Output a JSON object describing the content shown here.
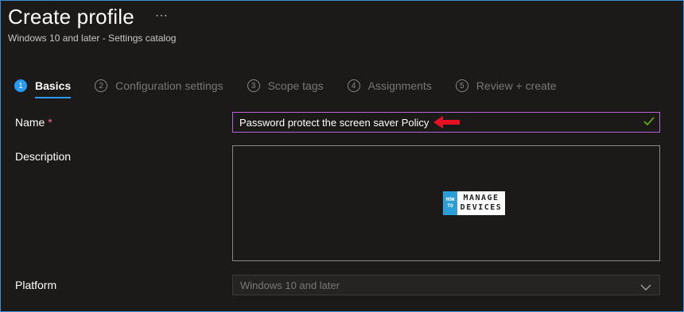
{
  "header": {
    "title": "Create profile",
    "more_label": "···",
    "subtitle": "Windows 10 and later - Settings catalog"
  },
  "tabs": [
    {
      "number": "1",
      "label": "Basics",
      "active": true
    },
    {
      "number": "2",
      "label": "Configuration settings",
      "active": false
    },
    {
      "number": "3",
      "label": "Scope tags",
      "active": false
    },
    {
      "number": "4",
      "label": "Assignments",
      "active": false
    },
    {
      "number": "5",
      "label": "Review + create",
      "active": false
    }
  ],
  "form": {
    "name": {
      "label": "Name",
      "required_marker": "*",
      "value": "Password protect the screen saver Policy"
    },
    "description": {
      "label": "Description",
      "value": ""
    },
    "platform": {
      "label": "Platform",
      "value": "Windows 10 and later"
    }
  },
  "watermark": {
    "line1": "HOW",
    "line2": "TO",
    "word1": "MANAGE",
    "word2": "DEVICES"
  },
  "icons": {
    "more": "ellipsis-icon",
    "arrow": "red-arrow-annotation-icon",
    "check": "checkmark-icon",
    "chevron": "chevron-down-icon"
  },
  "colors": {
    "accent": "#2899f5",
    "input_border_focus": "#b464d6",
    "required": "#f1707b",
    "check": "#6bb700",
    "annotation_arrow": "#e81123"
  }
}
